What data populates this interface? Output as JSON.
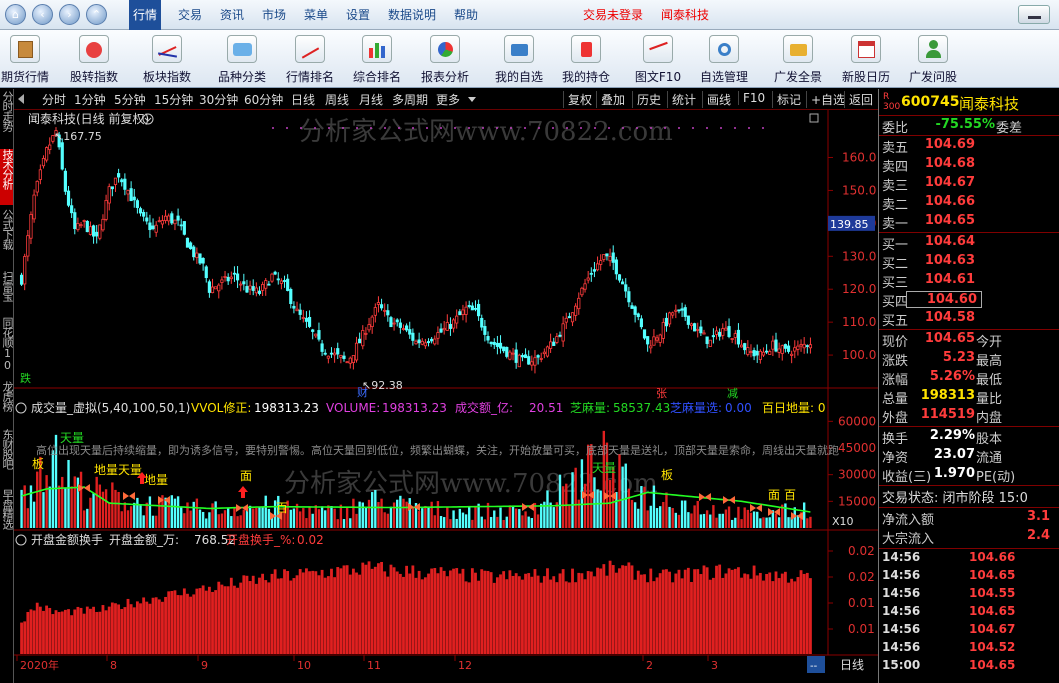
{
  "menubar": {
    "items": [
      "行情",
      "交易",
      "资讯",
      "市场",
      "菜单",
      "设置",
      "数据说明",
      "帮助"
    ],
    "status_login": "交易未登录",
    "status_brand": "闻泰科技"
  },
  "toolbar": {
    "buttons": [
      "期货行情",
      "股转指数",
      "板块指数",
      "品种分类",
      "行情排名",
      "综合排名",
      "报表分析",
      "我的自选",
      "我的持仓",
      "图文F10",
      "自选管理",
      "广发全景",
      "新股日历",
      "广发问股"
    ]
  },
  "lefttabs": [
    "分时走势",
    "技术分析",
    "公式下载",
    "扫雷宝",
    "同花顺10",
    "龙虎榜",
    "东财股吧",
    "早盘精选"
  ],
  "periodbar": {
    "periods": [
      "分时",
      "1分钟",
      "5分钟",
      "15分钟",
      "30分钟",
      "60分钟",
      "日线",
      "周线",
      "月线",
      "多周期",
      "更多"
    ],
    "tools": [
      "复权",
      "叠加",
      "历史",
      "统计",
      "画线",
      "F10",
      "标记",
      "+自选",
      "返回"
    ]
  },
  "chart": {
    "title": "闻泰科技(日线 前复权)",
    "watermark": "分析家公式网www.70822.com",
    "price_high_label": "167.75",
    "price_low_label": "92.38",
    "current_price_tag": "139.85",
    "candle_marks": [
      "跌",
      "财",
      "张",
      "减"
    ],
    "price_ticks": [
      "160.0",
      "150.0",
      "140.0",
      "130.0",
      "120.0",
      "110.0",
      "100.0"
    ],
    "volume_header": {
      "name": "成交量_虚拟(5,40,100,50,1)",
      "vvol_label": "VVOL修正: ",
      "vvol_value": "198313.23",
      "volume_label": "VOLUME: ",
      "volume_value": "198313.23",
      "amount_label": "成交额_亿: ",
      "amount_value": "20.51",
      "sesame_label": "芝麻量: ",
      "sesame_value": "58537.43",
      "sesame_select_label": "芝麻量选: ",
      "sesame_select_value": "0.00",
      "hundred_day_label": "百日地量: 0"
    },
    "volume_ticks": [
      "60000",
      "45000",
      "30000",
      "15000"
    ],
    "volume_multiplier": "X10",
    "volume_note": "高位出现天量后持续缩量，即为诱多信号，要特别警惕。高位天量回到低位，频繁出蝴蝶，关注，开始放量可买，底部天量是送礼，顶部天量是索命，周线出天量就跑",
    "volume_marks": [
      "天量",
      "板",
      "地量天量",
      "地量",
      "板",
      "天量",
      "面",
      "百",
      "面",
      "百"
    ],
    "turnover_header": {
      "name": "开盘金额换手",
      "amount_label": "开盘金额_万: ",
      "amount_value": "768.52",
      "turn_label": "开盘换手_%: ",
      "turn_value": "0.02"
    },
    "turnover_ticks": [
      "0.02",
      "0.02",
      "0.01",
      "0.01"
    ],
    "x_axis": [
      "2020年",
      "8",
      "9",
      "10",
      "11",
      "12",
      "2",
      "3"
    ],
    "period_button": "日线"
  },
  "chart_data": {
    "type": "candlestick",
    "title": "闻泰科技(日线 前复权)",
    "x_axis_labels": [
      "2020年",
      "8",
      "9",
      "10",
      "11",
      "12",
      "2",
      "3"
    ],
    "price_axis": {
      "ylim": [
        90,
        172
      ],
      "ticks": [
        100,
        110,
        120,
        130,
        140,
        150,
        160
      ]
    },
    "annotations": {
      "high": 167.75,
      "low": 92.38,
      "current": 139.85
    },
    "close_path_keypoints": [
      [
        0,
        123
      ],
      [
        4,
        148
      ],
      [
        8,
        162
      ],
      [
        11,
        168
      ],
      [
        14,
        150
      ],
      [
        17,
        138
      ],
      [
        20,
        140
      ],
      [
        24,
        135
      ],
      [
        28,
        150
      ],
      [
        31,
        155
      ],
      [
        34,
        150
      ],
      [
        38,
        142
      ],
      [
        42,
        138
      ],
      [
        46,
        142
      ],
      [
        50,
        140
      ],
      [
        54,
        132
      ],
      [
        58,
        127
      ],
      [
        60,
        120
      ],
      [
        64,
        122
      ],
      [
        68,
        124
      ],
      [
        72,
        120
      ],
      [
        76,
        119
      ],
      [
        80,
        124
      ],
      [
        84,
        121
      ],
      [
        88,
        113
      ],
      [
        92,
        108
      ],
      [
        96,
        102
      ],
      [
        100,
        100
      ],
      [
        104,
        98
      ],
      [
        108,
        104
      ],
      [
        111,
        110
      ],
      [
        114,
        115
      ],
      [
        118,
        110
      ],
      [
        122,
        108
      ],
      [
        126,
        104
      ],
      [
        130,
        105
      ],
      [
        134,
        107
      ],
      [
        138,
        110
      ],
      [
        142,
        114
      ],
      [
        145,
        113
      ],
      [
        150,
        104
      ],
      [
        155,
        101
      ],
      [
        160,
        98
      ],
      [
        165,
        99
      ],
      [
        170,
        104
      ],
      [
        174,
        110
      ],
      [
        178,
        118
      ],
      [
        182,
        125
      ],
      [
        186,
        130
      ],
      [
        189,
        128
      ],
      [
        192,
        122
      ],
      [
        196,
        113
      ],
      [
        200,
        103
      ],
      [
        204,
        107
      ],
      [
        208,
        113
      ],
      [
        212,
        112
      ],
      [
        216,
        107
      ],
      [
        220,
        104
      ],
      [
        224,
        108
      ],
      [
        228,
        106
      ],
      [
        232,
        101
      ],
      [
        236,
        100
      ],
      [
        240,
        103
      ],
      [
        244,
        101
      ],
      [
        248,
        102
      ],
      [
        252,
        104
      ]
    ],
    "volume_axis": {
      "ylim": [
        0,
        63000
      ],
      "ticks": [
        15000,
        30000,
        45000,
        60000
      ]
    },
    "volume_levels_keypoints": [
      [
        0,
        18000
      ],
      [
        8,
        45000
      ],
      [
        12,
        35000
      ],
      [
        20,
        22000
      ],
      [
        40,
        14000
      ],
      [
        60,
        11000
      ],
      [
        80,
        13000
      ],
      [
        100,
        9000
      ],
      [
        112,
        16000
      ],
      [
        130,
        11000
      ],
      [
        160,
        9000
      ],
      [
        175,
        24000
      ],
      [
        185,
        40000
      ],
      [
        195,
        22000
      ],
      [
        215,
        13000
      ],
      [
        235,
        7000
      ],
      [
        252,
        12000
      ]
    ],
    "volume_ma_keypoints": [
      [
        0,
        18000
      ],
      [
        8,
        22000
      ],
      [
        20,
        23000
      ],
      [
        28,
        14000
      ],
      [
        60,
        11000
      ],
      [
        80,
        12000
      ],
      [
        120,
        11500
      ],
      [
        170,
        12500
      ],
      [
        188,
        14000
      ],
      [
        200,
        20000
      ],
      [
        230,
        15000
      ],
      [
        252,
        9000
      ]
    ],
    "turnover_axis": {
      "ticks": [
        0.02,
        0.02,
        0.01,
        0.01
      ]
    },
    "turnover_levels_keypoints": [
      [
        0,
        0.3
      ],
      [
        5,
        0.45
      ],
      [
        10,
        0.38
      ],
      [
        25,
        0.4
      ],
      [
        40,
        0.5
      ],
      [
        60,
        0.6
      ],
      [
        80,
        0.7
      ],
      [
        110,
        0.78
      ],
      [
        130,
        0.74
      ],
      [
        150,
        0.7
      ],
      [
        175,
        0.72
      ],
      [
        190,
        0.78
      ],
      [
        205,
        0.7
      ],
      [
        225,
        0.76
      ],
      [
        240,
        0.72
      ],
      [
        252,
        0.7
      ]
    ]
  },
  "rightpanel": {
    "code": "600745",
    "name": "闻泰科技",
    "ratio_label": "委比",
    "ratio_value": "-75.55%",
    "ratio_label2": "委差",
    "asks": [
      {
        "label": "卖五",
        "price": "104.69"
      },
      {
        "label": "卖四",
        "price": "104.68"
      },
      {
        "label": "卖三",
        "price": "104.67"
      },
      {
        "label": "卖二",
        "price": "104.66"
      },
      {
        "label": "卖一",
        "price": "104.65"
      }
    ],
    "bids": [
      {
        "label": "买一",
        "price": "104.64"
      },
      {
        "label": "买二",
        "price": "104.63"
      },
      {
        "label": "买三",
        "price": "104.61"
      },
      {
        "label": "买四",
        "price": "104.60"
      },
      {
        "label": "买五",
        "price": "104.58"
      }
    ],
    "quote": [
      {
        "label": "现价",
        "value": "104.65",
        "label2": "今开",
        "color": "red"
      },
      {
        "label": "涨跌",
        "value": "5.23",
        "label2": "最高",
        "color": "red"
      },
      {
        "label": "涨幅",
        "value": "5.26%",
        "label2": "最低",
        "color": "red"
      },
      {
        "label": "总量",
        "value": "198313",
        "label2": "量比",
        "color": "yellow"
      },
      {
        "label": "外盘",
        "value": "114519",
        "label2": "内盘",
        "color": "red"
      }
    ],
    "finance": [
      {
        "label": "换手",
        "value": "2.29%",
        "label2": "股本"
      },
      {
        "label": "净资",
        "value": "23.07",
        "label2": "流通"
      },
      {
        "label": "收益(三)",
        "value": "1.970",
        "label2": "PE(动)"
      }
    ],
    "trade_state": "交易状态: 闭市阶段 15:0",
    "inflow_label": "净流入额",
    "inflow_value": "3.1",
    "bigorder_label": "大宗流入",
    "bigorder_value": "2.4",
    "ticks": [
      {
        "time": "14:56",
        "price": "104.66"
      },
      {
        "time": "14:56",
        "price": "104.65"
      },
      {
        "time": "14:56",
        "price": "104.55"
      },
      {
        "time": "14:56",
        "price": "104.65"
      },
      {
        "time": "14:56",
        "price": "104.67"
      },
      {
        "time": "14:56",
        "price": "104.52"
      },
      {
        "time": "15:00",
        "price": "104.65"
      }
    ]
  }
}
